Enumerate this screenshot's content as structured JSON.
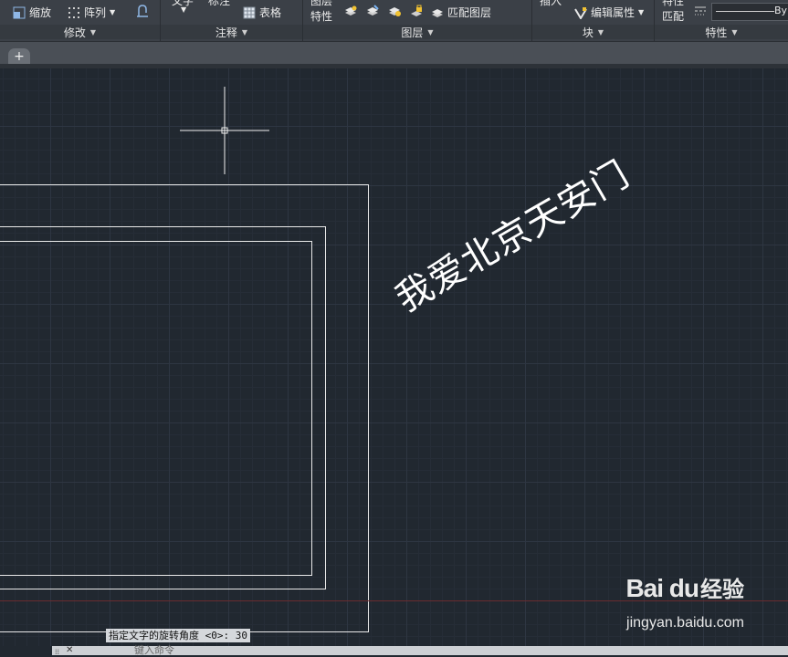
{
  "ribbon": {
    "panels": [
      {
        "title": "修改",
        "buttons": [
          "缩放",
          "阵列"
        ]
      },
      {
        "title": "注释",
        "buttons": [
          "文字",
          "标注",
          "表格"
        ]
      },
      {
        "title": "图层",
        "buttons": [
          "图层",
          "特性",
          "匹配图层"
        ]
      },
      {
        "title": "块",
        "buttons": [
          "插入",
          "编辑属性"
        ]
      },
      {
        "title": "特性",
        "buttons": [
          "特性",
          "匹配",
          "By"
        ]
      }
    ]
  },
  "tabs": {
    "add_label": "+"
  },
  "drawing": {
    "text": "我爱北京天安门"
  },
  "command": {
    "prompt": "指定文字的旋转角度 <0>: 30",
    "input_placeholder": "键入命令"
  },
  "watermark": {
    "brand": "Bai du",
    "cn": "经验",
    "url": "jingyan.baidu.com"
  },
  "colors": {
    "canvas": "#212830",
    "ribbon": "#3b4047",
    "lines": "#e9e9e9"
  }
}
